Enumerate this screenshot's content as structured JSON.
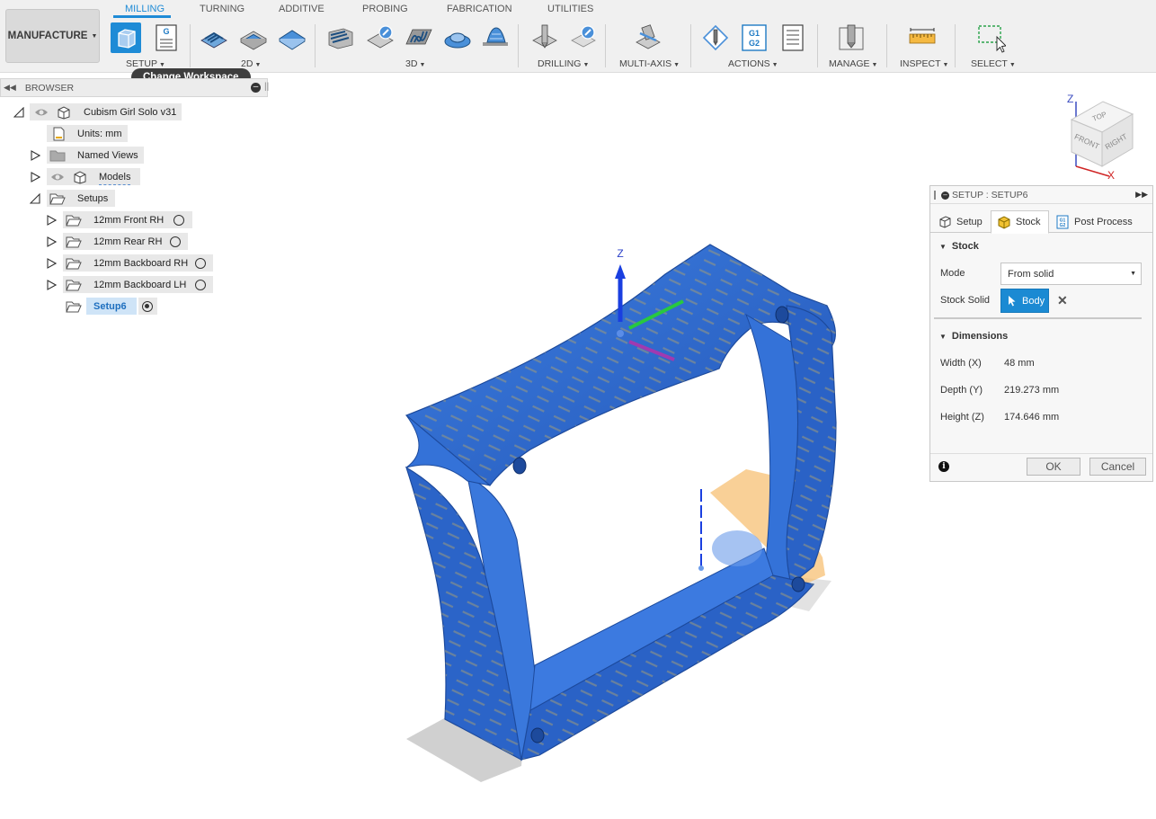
{
  "toolbar": {
    "workspace_button": "MANUFACTURE",
    "tabs": [
      "MILLING",
      "TURNING",
      "ADDITIVE",
      "PROBING",
      "FABRICATION",
      "UTILITIES"
    ],
    "groups": {
      "setup": "SETUP",
      "two_d": "2D",
      "three_d": "3D",
      "drilling": "DRILLING",
      "multi_axis": "MULTI-AXIS",
      "actions": "ACTIONS",
      "manage": "MANAGE",
      "inspect": "INSPECT",
      "select": "SELECT"
    },
    "icon_labels": {
      "g_code": "G",
      "g1g2_top": "G1",
      "g1g2_bottom": "G2"
    }
  },
  "tooltip": {
    "text": "Change Workspace"
  },
  "browser": {
    "title": "BROWSER",
    "root": "Cubism Girl Solo v31",
    "units": "Units: mm",
    "named_views": "Named Views",
    "models": "Models",
    "setups": "Setups",
    "setup_items": [
      "12mm Front RH",
      "12mm Rear RH",
      "12mm Backboard RH",
      "12mm Backboard LH"
    ],
    "active_setup": "Setup6"
  },
  "viewport": {
    "axis_z_label": "Z",
    "viewcube": {
      "top": "TOP",
      "front": "FRONT",
      "right": "RIGHT",
      "z": "Z",
      "x": "X"
    },
    "colors": {
      "model": "#2f6fd8",
      "stock": "#f7c074",
      "accent": "#1e8bd6"
    }
  },
  "dialog": {
    "title": "SETUP : SETUP6",
    "tabs": [
      "Setup",
      "Stock",
      "Post Process"
    ],
    "active_tab": "Stock",
    "stock_section": "Stock",
    "mode_label": "Mode",
    "mode_value": "From solid",
    "stock_solid_label": "Stock Solid",
    "stock_solid_value": "Body",
    "dimensions_section": "Dimensions",
    "width_label": "Width (X)",
    "width_value": "48 mm",
    "depth_label": "Depth (Y)",
    "depth_value": "219.273 mm",
    "height_label": "Height (Z)",
    "height_value": "174.646 mm",
    "ok": "OK",
    "cancel": "Cancel"
  }
}
